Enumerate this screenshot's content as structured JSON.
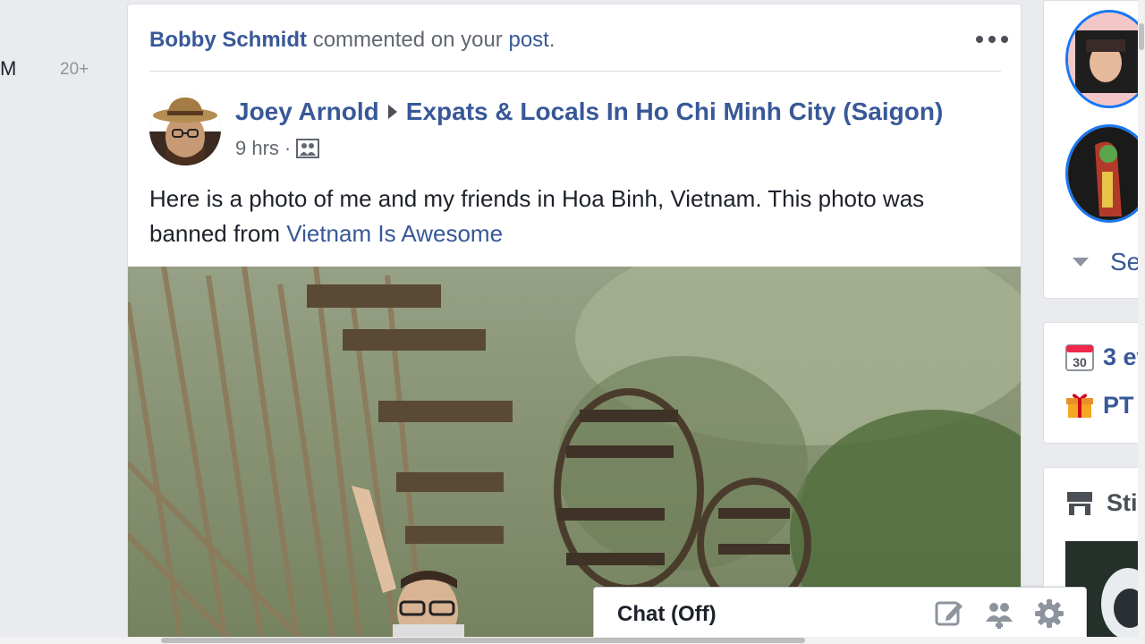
{
  "left": {
    "label_m": "M",
    "count": "20+"
  },
  "notification": {
    "actor": "Bobby Schmidt",
    "action": "commented on your",
    "object": "post",
    "period": "."
  },
  "post": {
    "author": "Joey Arnold",
    "group": "Expats & Locals In Ho Chi Minh City (Saigon)",
    "time": "9 hrs",
    "separator": "·",
    "text": "Here is a photo of me and my friends in Hoa Binh, Vietnam. This photo was banned from ",
    "text_link": "Vietnam Is Awesome"
  },
  "right": {
    "see_more": "Se",
    "events": "3 ev",
    "birthday": "PT",
    "calendar_day": "30",
    "store": "Sti"
  },
  "chat": {
    "label": "Chat (Off)"
  },
  "colors": {
    "link": "#385898",
    "background": "#e9ebee",
    "story_ring": "#1877f2"
  }
}
